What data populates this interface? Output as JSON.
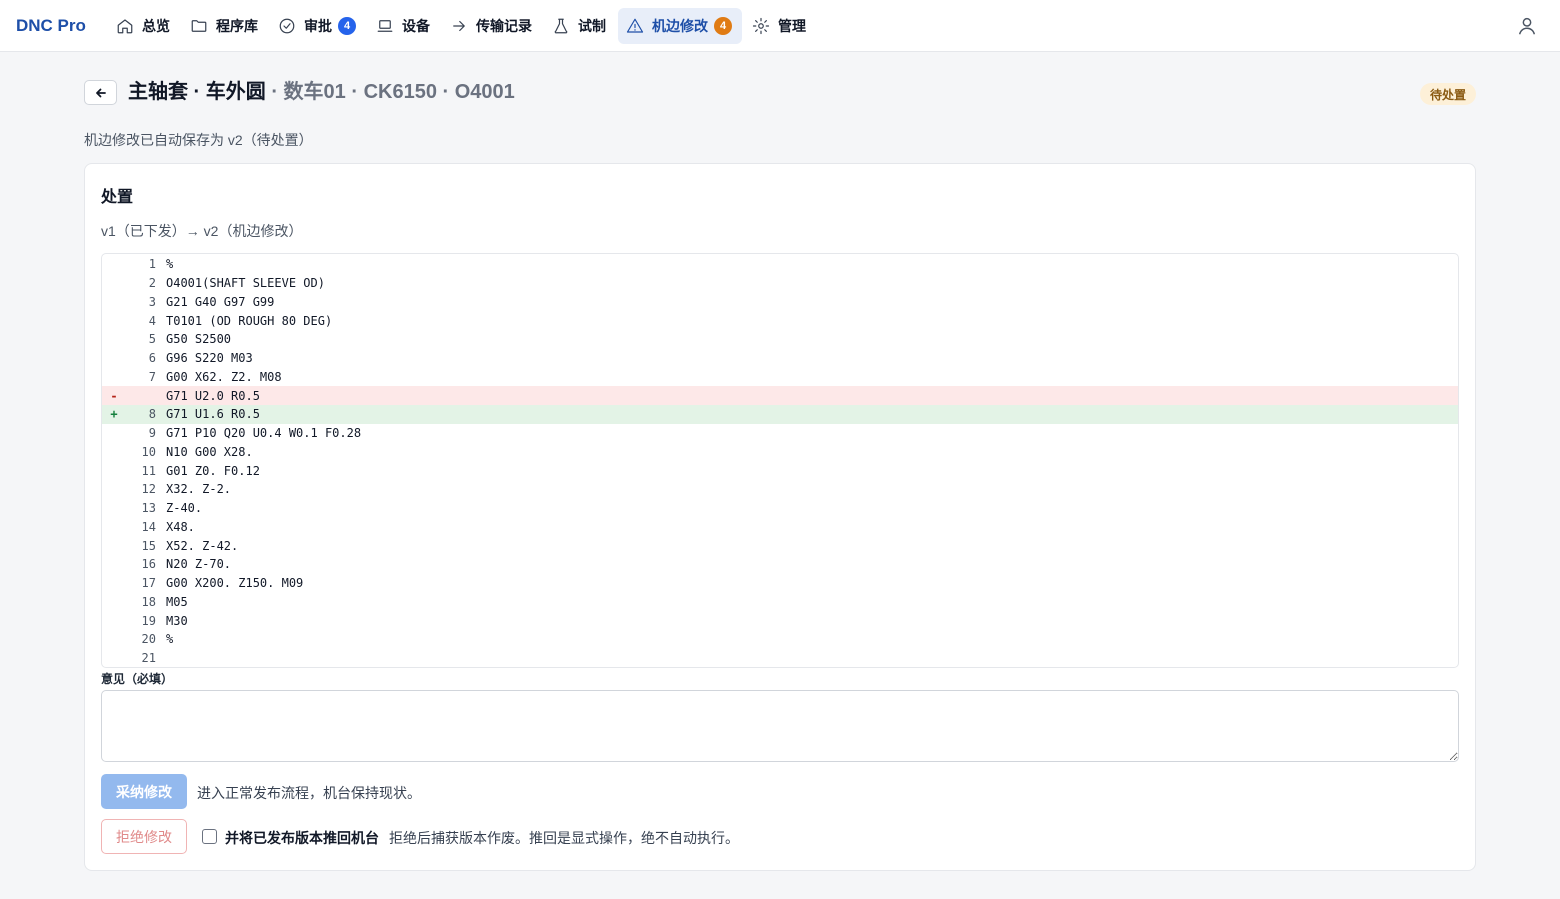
{
  "app": {
    "brand": "DNC Pro"
  },
  "nav": {
    "items": [
      {
        "label": "总览",
        "icon": "home-icon"
      },
      {
        "label": "程序库",
        "icon": "folder-icon"
      },
      {
        "label": "审批",
        "icon": "check-circle-icon",
        "badge": "4",
        "badge_color": "#2563eb"
      },
      {
        "label": "设备",
        "icon": "laptop-icon"
      },
      {
        "label": "传输记录",
        "icon": "arrow-right-icon"
      },
      {
        "label": "试制",
        "icon": "flask-icon"
      },
      {
        "label": "机边修改",
        "icon": "warning-triangle-icon",
        "badge": "4",
        "badge_color": "#e07b14",
        "active": true
      },
      {
        "label": "管理",
        "icon": "gear-icon"
      }
    ]
  },
  "header": {
    "title": "主轴套 · 车外圆",
    "subtitle": " · 数车01 · CK6150 · O4001",
    "status": "待处置"
  },
  "autosave_note": "机边修改已自动保存为 v2（待处置）",
  "card": {
    "title": "处置",
    "diff_label": "v1（已下发）→ v2（机边修改）",
    "code_lines": [
      {
        "mark": "",
        "ln": "1",
        "text": "%",
        "type": ""
      },
      {
        "mark": "",
        "ln": "2",
        "text": "O4001(SHAFT SLEEVE OD)",
        "type": ""
      },
      {
        "mark": "",
        "ln": "3",
        "text": "G21 G40 G97 G99",
        "type": ""
      },
      {
        "mark": "",
        "ln": "4",
        "text": "T0101 (OD ROUGH 80 DEG)",
        "type": ""
      },
      {
        "mark": "",
        "ln": "5",
        "text": "G50 S2500",
        "type": ""
      },
      {
        "mark": "",
        "ln": "6",
        "text": "G96 S220 M03",
        "type": ""
      },
      {
        "mark": "",
        "ln": "7",
        "text": "G00 X62. Z2. M08",
        "type": ""
      },
      {
        "mark": "-",
        "ln": "",
        "text": "G71 U2.0 R0.5",
        "type": "del"
      },
      {
        "mark": "+",
        "ln": "8",
        "text": "G71 U1.6 R0.5",
        "type": "add"
      },
      {
        "mark": "",
        "ln": "9",
        "text": "G71 P10 Q20 U0.4 W0.1 F0.28",
        "type": ""
      },
      {
        "mark": "",
        "ln": "10",
        "text": "N10 G00 X28.",
        "type": ""
      },
      {
        "mark": "",
        "ln": "11",
        "text": "G01 Z0. F0.12",
        "type": ""
      },
      {
        "mark": "",
        "ln": "12",
        "text": "X32. Z-2.",
        "type": ""
      },
      {
        "mark": "",
        "ln": "13",
        "text": "Z-40.",
        "type": ""
      },
      {
        "mark": "",
        "ln": "14",
        "text": "X48.",
        "type": ""
      },
      {
        "mark": "",
        "ln": "15",
        "text": "X52. Z-42.",
        "type": ""
      },
      {
        "mark": "",
        "ln": "16",
        "text": "N20 Z-70.",
        "type": ""
      },
      {
        "mark": "",
        "ln": "17",
        "text": "G00 X200. Z150. M09",
        "type": ""
      },
      {
        "mark": "",
        "ln": "18",
        "text": "M05",
        "type": ""
      },
      {
        "mark": "",
        "ln": "19",
        "text": "M30",
        "type": ""
      },
      {
        "mark": "",
        "ln": "20",
        "text": "%",
        "type": ""
      },
      {
        "mark": "",
        "ln": "21",
        "text": "",
        "type": ""
      }
    ],
    "comment_label": "意见（必填）",
    "comment_value": "",
    "accept_label": "采纳修改",
    "accept_desc": "进入正常发布流程，机台保持现状。",
    "reject_label": "拒绝修改",
    "push_back_label": "并将已发布版本推回机台",
    "push_back_checked": false,
    "reject_desc": "拒绝后捕获版本作废。推回是显式操作，绝不自动执行。"
  }
}
